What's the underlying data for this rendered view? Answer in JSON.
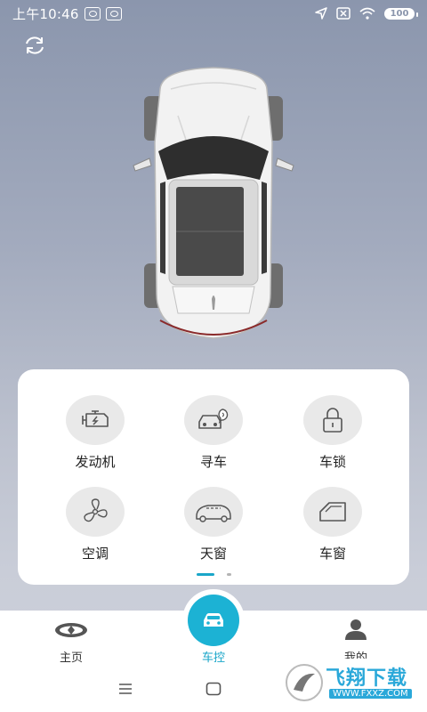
{
  "status_bar": {
    "time": "上午10:46",
    "battery": "100"
  },
  "controls": [
    {
      "label": "发动机",
      "icon": "engine-icon"
    },
    {
      "label": "寻车",
      "icon": "find-car-icon"
    },
    {
      "label": "车锁",
      "icon": "lock-icon"
    },
    {
      "label": "空调",
      "icon": "fan-icon"
    },
    {
      "label": "天窗",
      "icon": "sunroof-icon"
    },
    {
      "label": "车窗",
      "icon": "window-icon"
    }
  ],
  "pager": {
    "current": 1,
    "total": 2
  },
  "tabs": [
    {
      "label": "主页",
      "icon": "brand-logo-icon",
      "active": false
    },
    {
      "label": "车控",
      "icon": "car-icon",
      "active": true
    },
    {
      "label": "我的",
      "icon": "user-icon",
      "active": false
    }
  ],
  "watermark": {
    "text": "飞翔下载",
    "url": "WWW.FXXZ.COM"
  },
  "colors": {
    "accent": "#1cb2d4",
    "background_top": "#8b96ad"
  }
}
